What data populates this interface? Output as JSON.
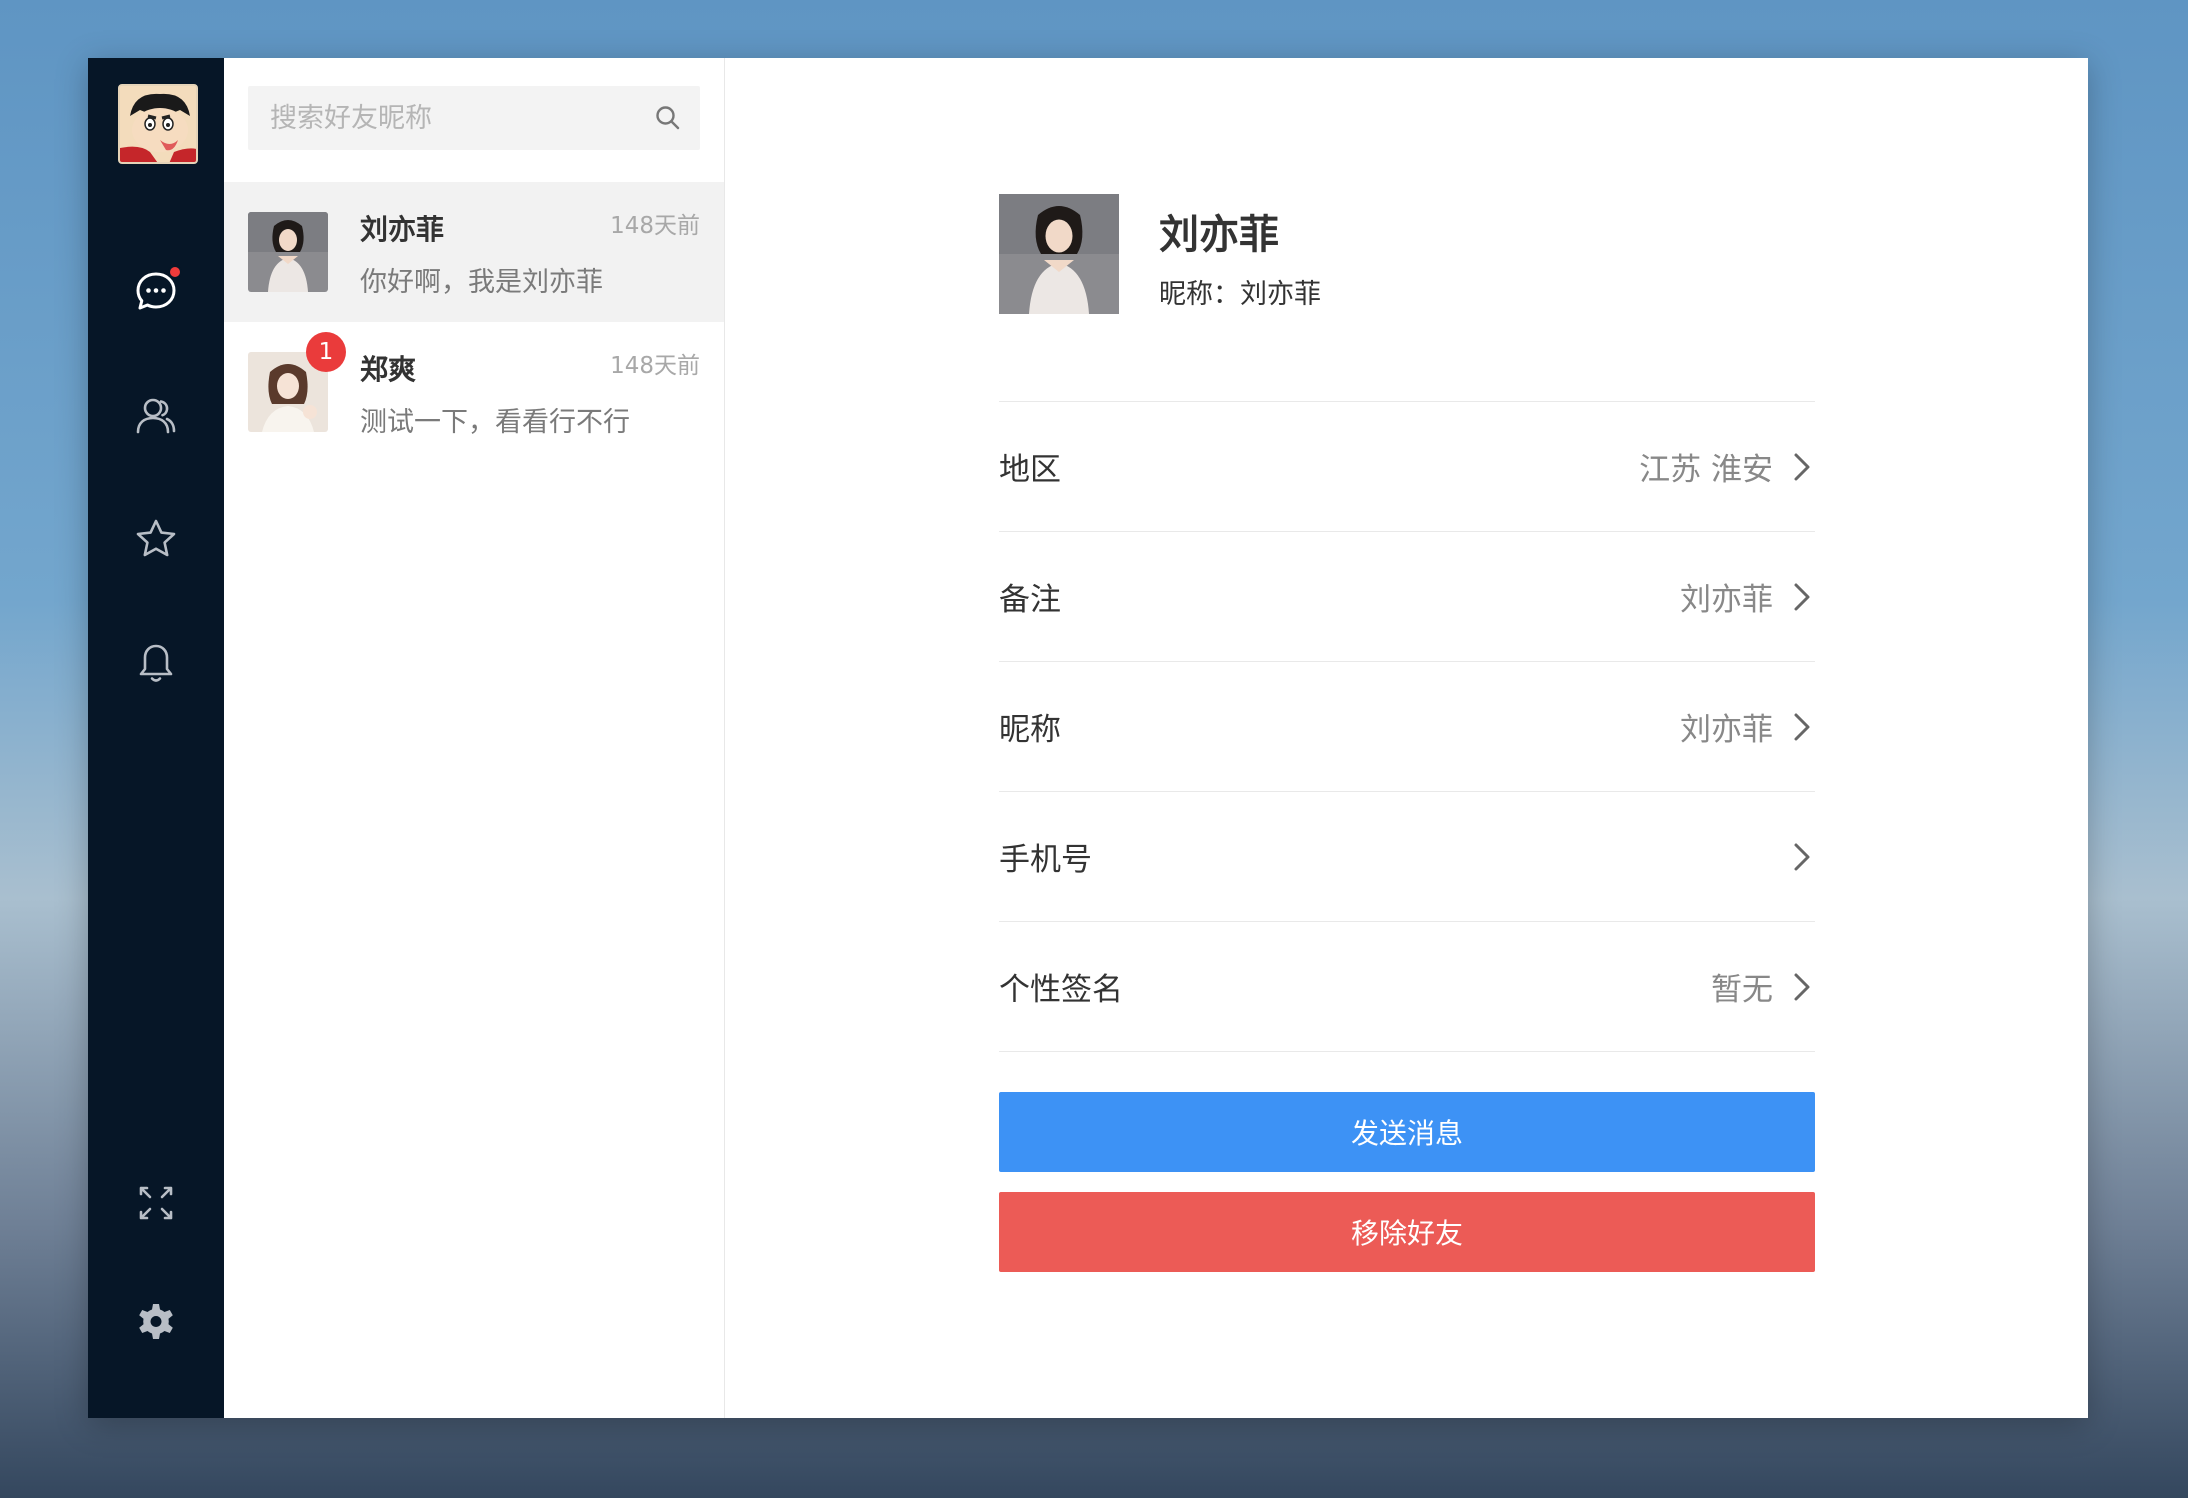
{
  "sidebar": {
    "nav": [
      {
        "icon": "chat-icon",
        "unread_dot": true
      },
      {
        "icon": "contacts-icon"
      },
      {
        "icon": "star-icon"
      },
      {
        "icon": "bell-icon"
      }
    ],
    "bottom": [
      {
        "icon": "fullscreen-icon"
      },
      {
        "icon": "settings-icon"
      }
    ]
  },
  "search": {
    "placeholder": "搜索好友昵称"
  },
  "conversations": [
    {
      "name": "刘亦菲",
      "time": "148天前",
      "preview": "你好啊，我是刘亦菲",
      "active": true
    },
    {
      "name": "郑爽",
      "time": "148天前",
      "preview": "测试一下，看看行不行",
      "unread": "1"
    }
  ],
  "profile": {
    "name": "刘亦菲",
    "nickname_line": "昵称：刘亦菲",
    "rows": [
      {
        "label": "地区",
        "value": "江苏 淮安"
      },
      {
        "label": "备注",
        "value": "刘亦菲"
      },
      {
        "label": "昵称",
        "value": "刘亦菲"
      },
      {
        "label": "手机号",
        "value": ""
      },
      {
        "label": "个性签名",
        "value": "暂无"
      }
    ],
    "send_label": "发送消息",
    "remove_label": "移除好友"
  },
  "colors": {
    "rail": "#061627",
    "primary": "#3d92f5",
    "danger": "#ec5b56",
    "badge": "#ea3b3b"
  }
}
